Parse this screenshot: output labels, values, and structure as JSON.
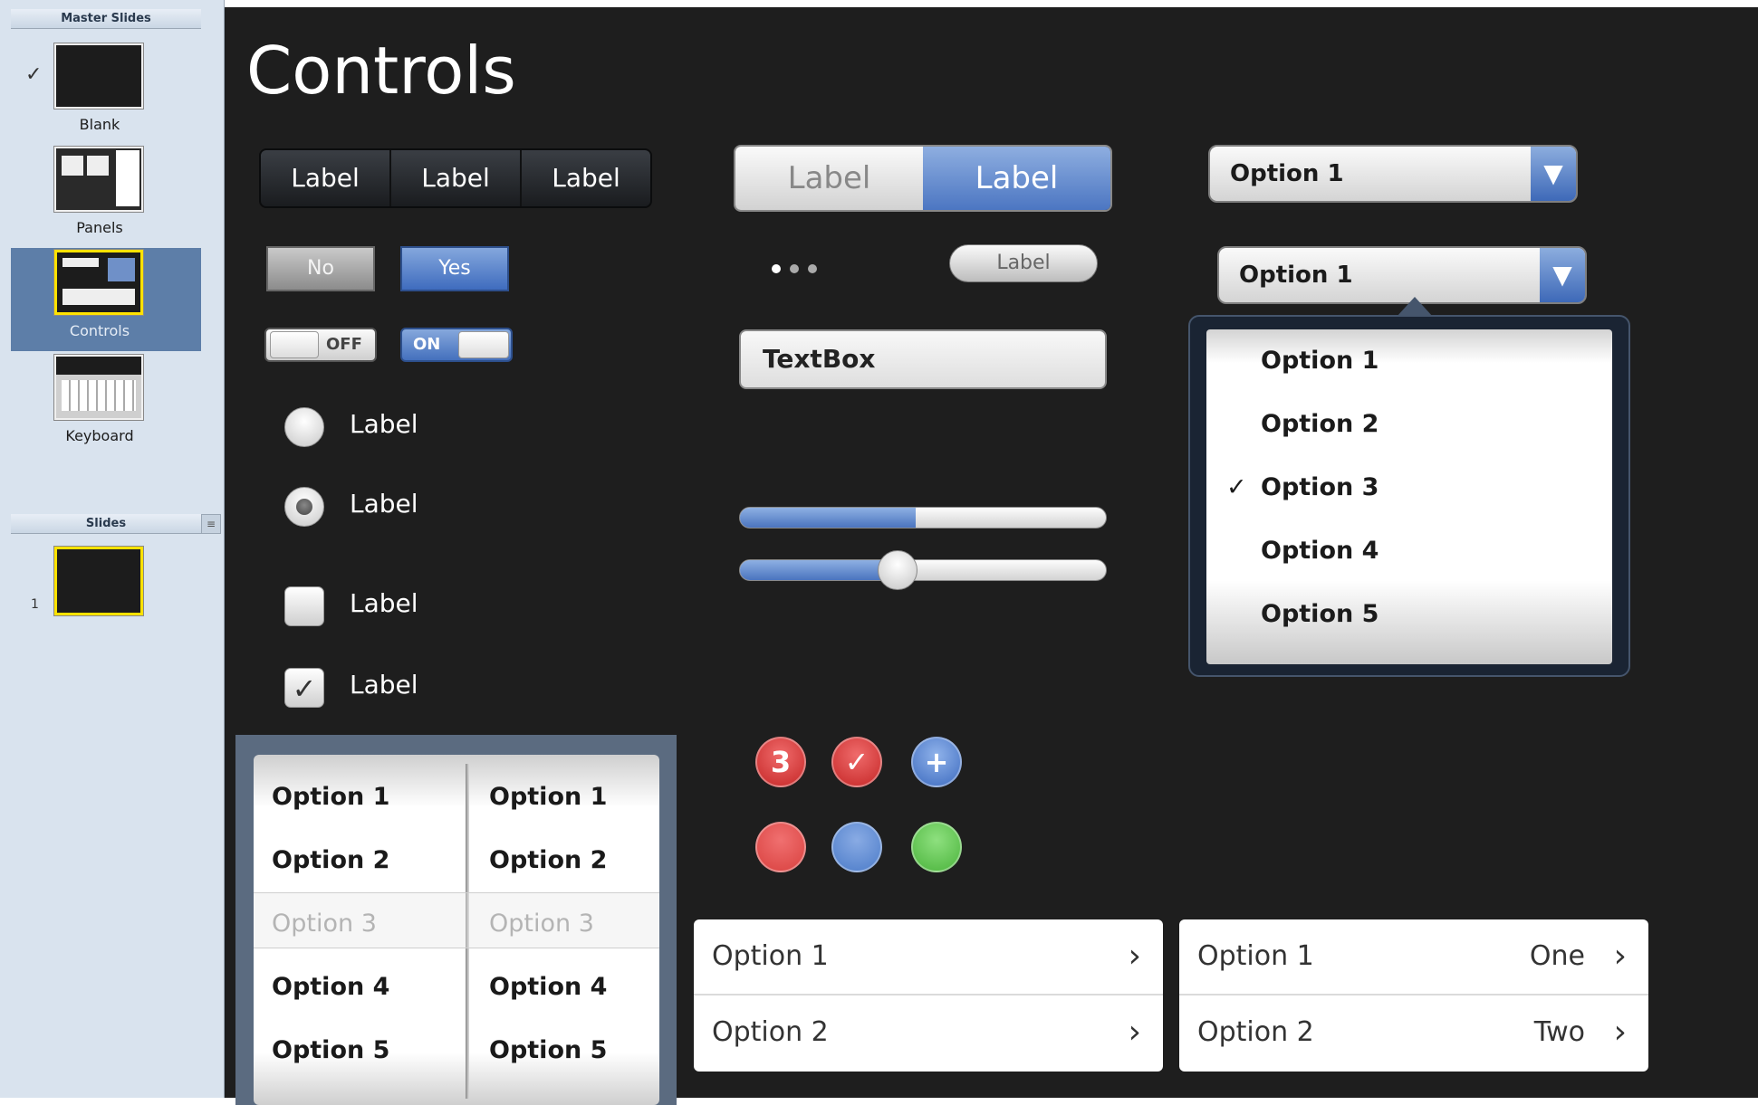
{
  "sidebar": {
    "master_header": "Master Slides",
    "masters": [
      {
        "label": "Blank",
        "checked": true
      },
      {
        "label": "Panels"
      },
      {
        "label": "Controls",
        "selected": true
      },
      {
        "label": "Keyboard"
      }
    ],
    "slides_header": "Slides",
    "slides": [
      {
        "number": "1"
      }
    ]
  },
  "main": {
    "title": "Controls",
    "segmented_dark": [
      "Label",
      "Label",
      "Label"
    ],
    "buttons": {
      "no": "No",
      "yes": "Yes"
    },
    "toggles": {
      "off": "OFF",
      "on": "ON"
    },
    "radios": [
      {
        "label": "Label",
        "selected": false
      },
      {
        "label": "Label",
        "selected": true
      }
    ],
    "checkboxes": [
      {
        "label": "Label",
        "checked": false
      },
      {
        "label": "Label",
        "checked": true
      }
    ],
    "picker": {
      "col1": [
        "Option 1",
        "Option 2",
        "Option 3",
        "Option 4",
        "Option 5"
      ],
      "col2": [
        "Option 1",
        "Option 2",
        "Option 3",
        "Option 4",
        "Option 5"
      ],
      "selected_index": 2
    },
    "segmented_light": [
      {
        "label": "Label",
        "selected": false
      },
      {
        "label": "Label",
        "selected": true
      }
    ],
    "page_dots": 3,
    "pill_label": "Label",
    "textbox_value": "TextBox",
    "progress_value": 0.48,
    "slider_value": 0.43,
    "badges": {
      "count": "3",
      "check": "✓",
      "plus": "+"
    },
    "status_dots": {
      "red": "#d9413f",
      "blue": "#4c7cc9",
      "green": "#4bb43c"
    },
    "dropdown1": {
      "value": "Option 1"
    },
    "dropdown2": {
      "value": "Option 1",
      "options": [
        "Option 1",
        "Option 2",
        "Option 3",
        "Option 4",
        "Option 5"
      ],
      "checked_index": 2
    },
    "list1": [
      {
        "label": "Option 1"
      },
      {
        "label": "Option 2"
      }
    ],
    "list2": [
      {
        "label": "Option 1",
        "value": "One"
      },
      {
        "label": "Option 2",
        "value": "Two"
      }
    ]
  }
}
